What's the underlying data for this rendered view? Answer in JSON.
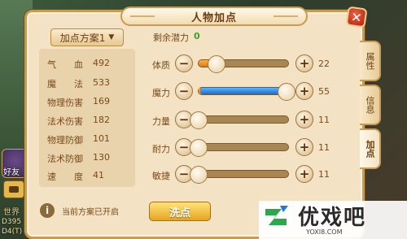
{
  "window": {
    "title": "人物加点",
    "close_label": "✕"
  },
  "scheme": {
    "label": "加点方案1",
    "chevron": "▼"
  },
  "stats": [
    {
      "key": "气　　血",
      "value": "492"
    },
    {
      "key": "魔　　法",
      "value": "533"
    },
    {
      "key": "物理伤害",
      "value": "169"
    },
    {
      "key": "法术伤害",
      "value": "182"
    },
    {
      "key": "物理防御",
      "value": "101"
    },
    {
      "key": "法术防御",
      "value": "130"
    },
    {
      "key": "速　　度",
      "value": "41"
    }
  ],
  "note": {
    "info_icon": "i",
    "text": "当前方案已开启"
  },
  "potential": {
    "label": "剩余潜力",
    "value": "0"
  },
  "attributes": [
    {
      "label": "体质",
      "value": "22",
      "orange_fraction": 0.2,
      "blue_fraction": 0.0,
      "knob_fraction": 0.2
    },
    {
      "label": "魔力",
      "value": "55",
      "orange_fraction": 0.02,
      "blue_fraction": 0.98,
      "knob_fraction": 0.98
    },
    {
      "label": "力量",
      "value": "11",
      "orange_fraction": 0.0,
      "blue_fraction": 0.0,
      "knob_fraction": 0.0
    },
    {
      "label": "耐力",
      "value": "11",
      "orange_fraction": 0.0,
      "blue_fraction": 0.0,
      "knob_fraction": 0.0
    },
    {
      "label": "敏捷",
      "value": "11",
      "orange_fraction": 0.0,
      "blue_fraction": 0.0,
      "knob_fraction": 0.0
    }
  ],
  "buttons": {
    "minus": "−",
    "plus": "+",
    "reset": "洗点"
  },
  "tabs": [
    {
      "label": "属性",
      "active": false
    },
    {
      "label": "信息",
      "active": false
    },
    {
      "label": "加点",
      "active": true
    }
  ],
  "hud": {
    "friend": "好友",
    "world": "世界",
    "coord1": "D395",
    "coord2": "D4(T)"
  },
  "watermark": {
    "brand": "优戏吧",
    "url": "YOXI8.COM"
  },
  "colors": {
    "potential_value": "#3fa02a",
    "orange_fill": "#e07a10",
    "blue_fill": "#1a6ad0",
    "reset_button": "#e5a520"
  }
}
